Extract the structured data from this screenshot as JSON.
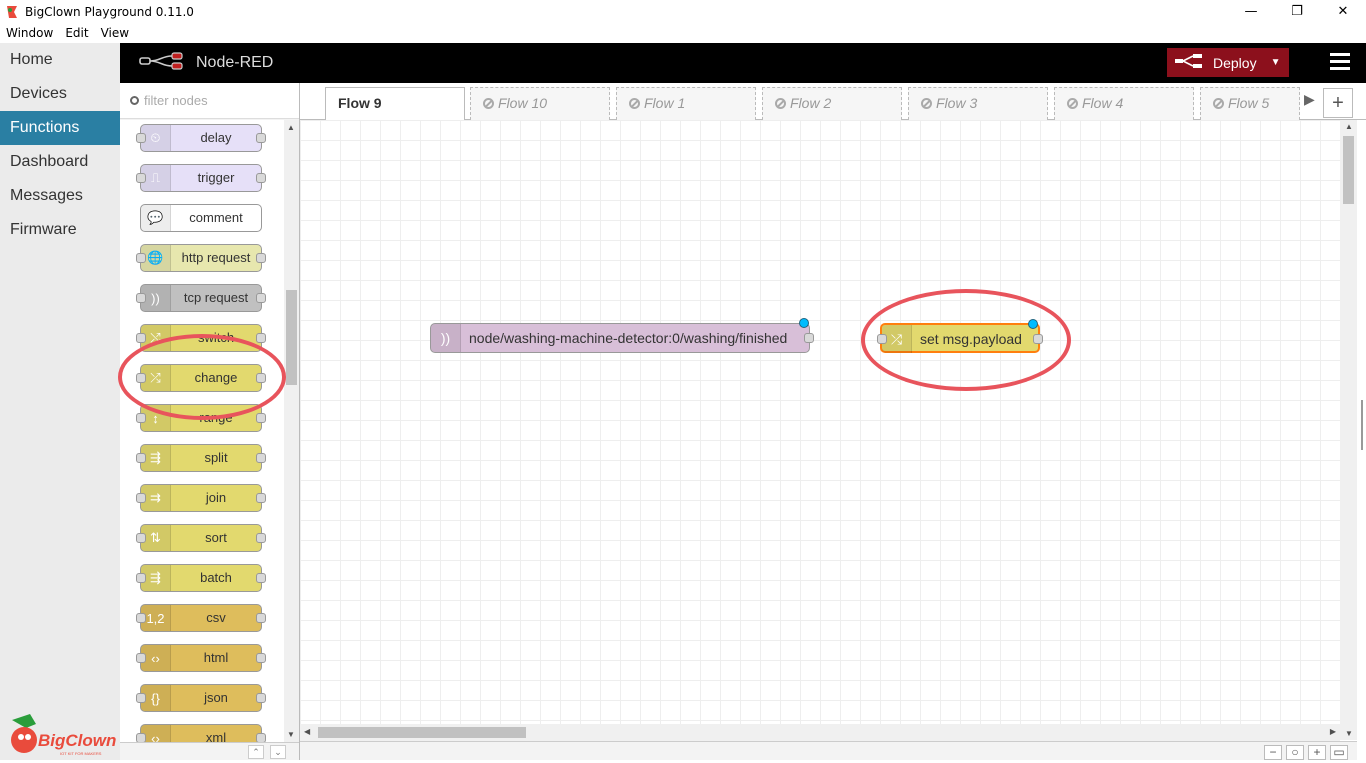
{
  "window": {
    "title": "BigClown Playground 0.11.0",
    "minimize": "—",
    "restore": "❐",
    "close": "✕"
  },
  "menu": [
    "Window",
    "Edit",
    "View"
  ],
  "app_nav": {
    "items": [
      "Home",
      "Devices",
      "Functions",
      "Dashboard",
      "Messages",
      "Firmware"
    ],
    "active": "Functions",
    "logo_text": "BigClown",
    "logo_tagline": "IOT KIT FOR MAKERS"
  },
  "header": {
    "title": "Node-RED",
    "deploy_label": "Deploy",
    "deploy_color": "#8c101c"
  },
  "palette": {
    "filter_placeholder": "filter nodes",
    "nodes": [
      {
        "label": "delay",
        "color": "#e6e0f8",
        "icon": "clock-icon",
        "glyph": "⏲",
        "in": true,
        "out": true
      },
      {
        "label": "trigger",
        "color": "#e6e0f8",
        "icon": "trigger-icon",
        "glyph": "⎍",
        "in": true,
        "out": true
      },
      {
        "label": "comment",
        "color": "#ffffff",
        "icon": "comment-icon",
        "glyph": "💬",
        "in": false,
        "out": false
      },
      {
        "label": "http request",
        "color": "#e7e7ae",
        "icon": "globe-icon",
        "glyph": "🌐",
        "in": true,
        "out": true
      },
      {
        "label": "tcp request",
        "color": "#c0c0c0",
        "icon": "wireless-icon",
        "glyph": "))",
        "in": true,
        "out": true
      },
      {
        "label": "switch",
        "color": "#e2d96e",
        "icon": "switch-icon",
        "glyph": "⤭",
        "in": true,
        "out": true
      },
      {
        "label": "change",
        "color": "#e2d96e",
        "icon": "shuffle-icon",
        "glyph": "⤮",
        "in": true,
        "out": true
      },
      {
        "label": "range",
        "color": "#e2d96e",
        "icon": "range-icon",
        "glyph": "↕",
        "in": true,
        "out": true
      },
      {
        "label": "split",
        "color": "#e2d96e",
        "icon": "split-icon",
        "glyph": "⇶",
        "in": true,
        "out": true
      },
      {
        "label": "join",
        "color": "#e2d96e",
        "icon": "join-icon",
        "glyph": "⇉",
        "in": true,
        "out": true
      },
      {
        "label": "sort",
        "color": "#e2d96e",
        "icon": "sort-icon",
        "glyph": "⇅",
        "in": true,
        "out": true
      },
      {
        "label": "batch",
        "color": "#e2d96e",
        "icon": "batch-icon",
        "glyph": "⇶",
        "in": true,
        "out": true
      },
      {
        "label": "csv",
        "color": "#debd5c",
        "icon": "csv-icon",
        "glyph": "1,2",
        "in": true,
        "out": true
      },
      {
        "label": "html",
        "color": "#debd5c",
        "icon": "html-icon",
        "glyph": "‹›",
        "in": true,
        "out": true
      },
      {
        "label": "json",
        "color": "#debd5c",
        "icon": "json-icon",
        "glyph": "{}",
        "in": true,
        "out": true
      },
      {
        "label": "xml",
        "color": "#debd5c",
        "icon": "xml-icon",
        "glyph": "‹›",
        "in": true,
        "out": true
      }
    ]
  },
  "tabs": [
    {
      "label": "Flow 9",
      "active": true,
      "disabled": false
    },
    {
      "label": "Flow 10",
      "active": false,
      "disabled": true
    },
    {
      "label": "Flow 1",
      "active": false,
      "disabled": true
    },
    {
      "label": "Flow 2",
      "active": false,
      "disabled": true
    },
    {
      "label": "Flow 3",
      "active": false,
      "disabled": true
    },
    {
      "label": "Flow 4",
      "active": false,
      "disabled": true
    },
    {
      "label": "Flow 5",
      "active": false,
      "disabled": true
    }
  ],
  "canvas_nodes": [
    {
      "label": "node/washing-machine-detector:0/washing/finished",
      "type": "mqtt-in",
      "color": "#d8bfd8",
      "icon": "wireless-icon",
      "glyph": "))",
      "changed": true
    },
    {
      "label": "set msg.payload",
      "type": "change",
      "color": "#e2d96e",
      "icon": "shuffle-icon",
      "glyph": "⤮",
      "changed": true,
      "selected": true
    }
  ],
  "footer_controls": [
    "−",
    "○",
    "+",
    "▭"
  ],
  "highlight_color": "#e8545c"
}
